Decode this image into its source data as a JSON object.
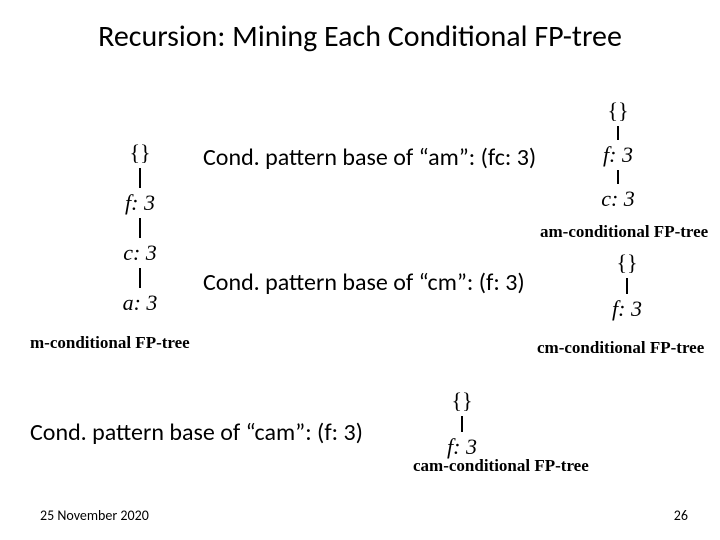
{
  "title": "Recursion: Mining Each Conditional FP-tree",
  "trees": {
    "m": {
      "root": "{}",
      "n1": "f: 3",
      "n2": "c: 3",
      "n3": "a: 3",
      "caption": "m-conditional FP-tree"
    },
    "am": {
      "root": "{}",
      "n1": "f: 3",
      "n2": "c: 3",
      "caption": "am-conditional FP-tree"
    },
    "cm": {
      "root": "{}",
      "n1": "f: 3",
      "caption": "cm-conditional FP-tree"
    },
    "cam": {
      "root": "{}",
      "n1": "f: 3",
      "caption": "cam-conditional FP-tree"
    }
  },
  "cond": {
    "am": "Cond. pattern base of “am”: (fc: 3)",
    "cm": "Cond. pattern base of “cm”: (f: 3)",
    "cam": "Cond. pattern base of “cam”: (f: 3)"
  },
  "footer": {
    "date": "25 November 2020",
    "page": "26"
  }
}
